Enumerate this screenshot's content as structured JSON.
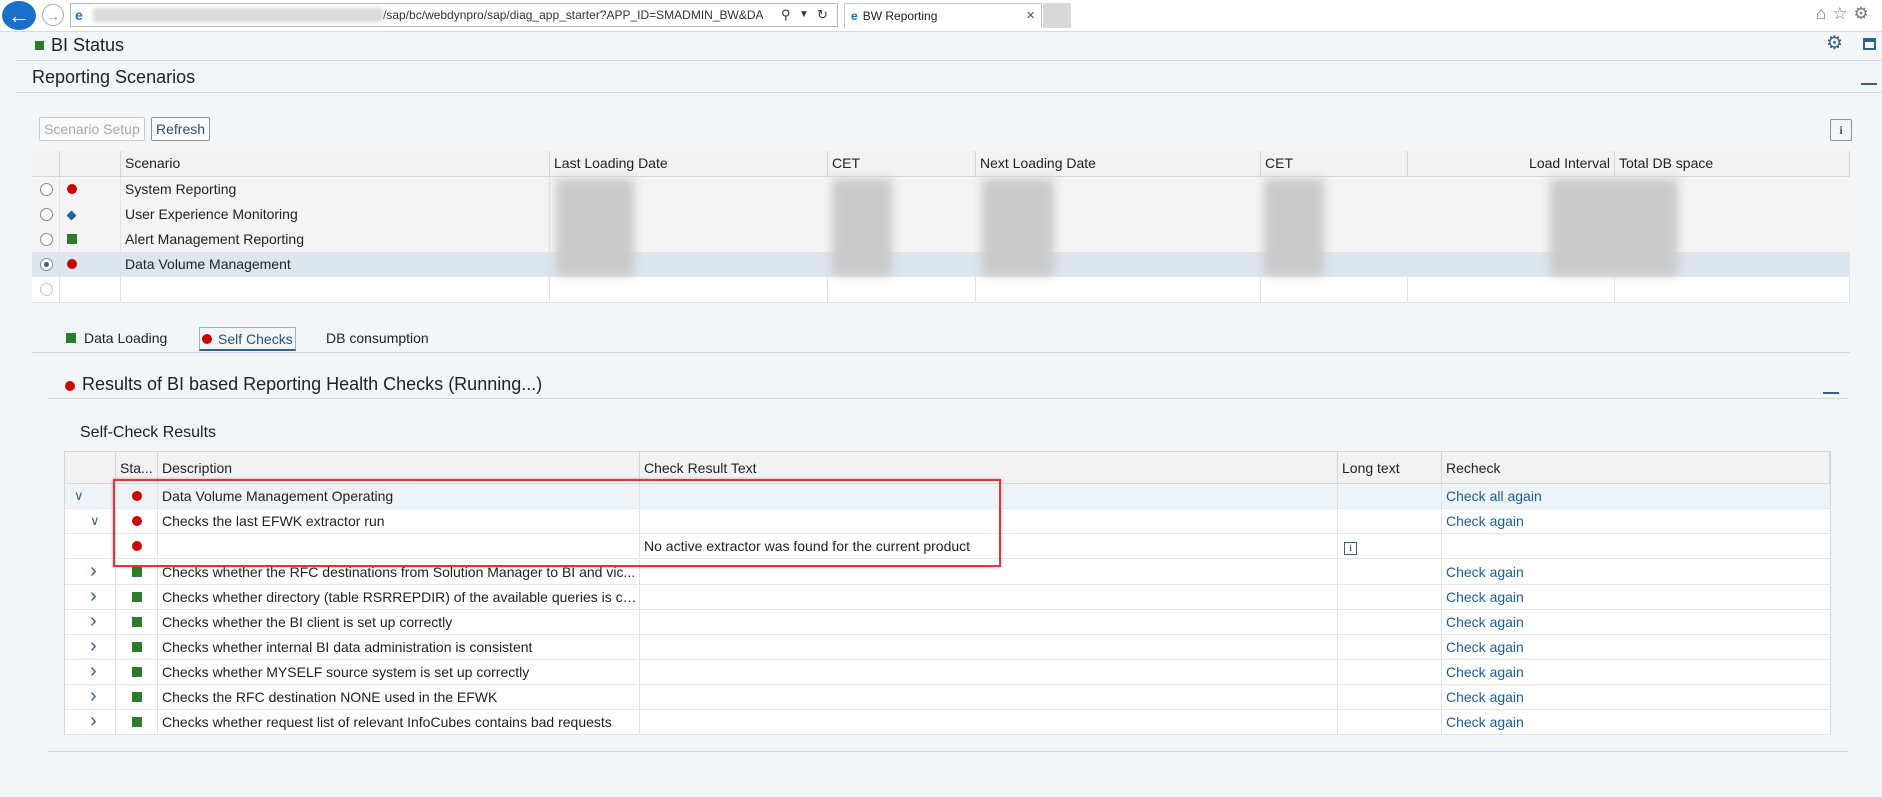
{
  "browser": {
    "url": "/sap/bc/webdynpro/sap/diag_app_starter?APP_ID=SMADMIN_BW&DATABASE",
    "tab_title": "BW Reporting"
  },
  "app": {
    "title": "BI Status"
  },
  "section": {
    "title": "Reporting Scenarios"
  },
  "toolbar": {
    "scenario_setup": "Scenario Setup",
    "refresh": "Refresh"
  },
  "scenario_table": {
    "headers": [
      "Scenario",
      "Last Loading Date",
      "CET",
      "Next Loading Date",
      "CET",
      "Load Interval",
      "Total DB space"
    ],
    "rows": [
      {
        "status": "red",
        "name": "System Reporting",
        "selected": false
      },
      {
        "status": "diamond",
        "name": "User Experience Monitoring",
        "selected": false
      },
      {
        "status": "green",
        "name": "Alert Management Reporting",
        "selected": false
      },
      {
        "status": "red",
        "name": "Data Volume Management",
        "selected": true
      }
    ]
  },
  "tabs": [
    {
      "label": "Data Loading",
      "status": "green"
    },
    {
      "label": "Self Checks",
      "status": "red"
    },
    {
      "label": "DB consumption",
      "status": ""
    }
  ],
  "results": {
    "title": "Results of BI based Reporting Health Checks (Running...)",
    "subtitle": "Self-Check Results",
    "headers": [
      "Sta...",
      "Description",
      "Check Result Text",
      "Long text",
      "Recheck"
    ],
    "rows": [
      {
        "expand": "down",
        "level": 0,
        "status": "red",
        "description": "Data Volume Management Operating",
        "result": "",
        "longtext": false,
        "recheck": "Check all again"
      },
      {
        "expand": "down",
        "level": 1,
        "status": "red",
        "description": "Checks the last EFWK extractor run",
        "result": "",
        "longtext": false,
        "recheck": "Check again"
      },
      {
        "expand": "",
        "level": 2,
        "status": "red",
        "description": "",
        "result": "No active extractor was found for the current product",
        "longtext": true,
        "recheck": ""
      },
      {
        "expand": "right",
        "level": 1,
        "status": "green",
        "description": "Checks whether the RFC destinations from Solution Manager to BI and vic...",
        "result": "",
        "longtext": false,
        "recheck": "Check again"
      },
      {
        "expand": "right",
        "level": 1,
        "status": "green",
        "description": "Checks whether directory (table RSRREPDIR) of the available queries is co...",
        "result": "",
        "longtext": false,
        "recheck": "Check again"
      },
      {
        "expand": "right",
        "level": 1,
        "status": "green",
        "description": "Checks whether the BI client is set up correctly",
        "result": "",
        "longtext": false,
        "recheck": "Check again"
      },
      {
        "expand": "right",
        "level": 1,
        "status": "green",
        "description": "Checks whether internal BI data administration is consistent",
        "result": "",
        "longtext": false,
        "recheck": "Check again"
      },
      {
        "expand": "right",
        "level": 1,
        "status": "green",
        "description": "Checks whether MYSELF source system is set up correctly",
        "result": "",
        "longtext": false,
        "recheck": "Check again"
      },
      {
        "expand": "right",
        "level": 1,
        "status": "green",
        "description": "Checks the RFC destination NONE used in the EFWK",
        "result": "",
        "longtext": false,
        "recheck": "Check again"
      },
      {
        "expand": "right",
        "level": 1,
        "status": "green",
        "description": "Checks whether request list of relevant InfoCubes contains bad requests",
        "result": "",
        "longtext": false,
        "recheck": "Check again"
      }
    ]
  },
  "colors": {
    "red": "#cc0000",
    "green": "#2b7d2b",
    "accent": "#346187",
    "link": "#1a5d9c"
  }
}
